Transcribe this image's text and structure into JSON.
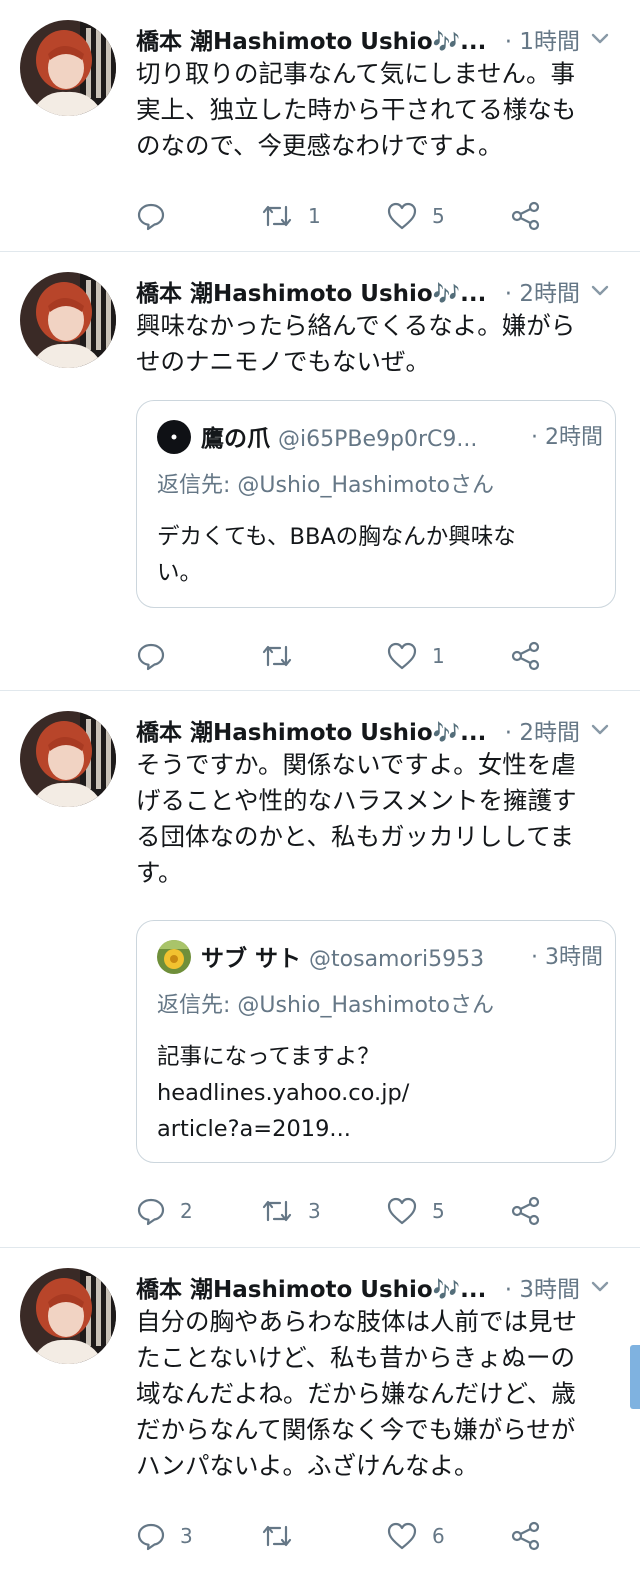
{
  "user": {
    "name": "橋本 潮Hashimoto Ushio",
    "music_glyph": "🎶",
    "ellipsis": "..."
  },
  "tweets": [
    {
      "time": "· 1時間",
      "text": [
        "切り取りの記事なんて気にしません。事",
        "実上、独立した時から干されてる様なも",
        "のなので、今更感なわけですよ。"
      ],
      "reply_count": "",
      "retweet_count": "1",
      "like_count": "5"
    },
    {
      "time": "· 2時間",
      "text": [
        "興味なかったら絡んでくるなよ。嫌がら",
        "せのナニモノでもないぜ。"
      ],
      "quote": {
        "name": "鷹の爪",
        "handle": "@i65PBe9p0rC9...",
        "time": "· 2時間",
        "reply_to": "返信先: @Ushio_Hashimotoさん",
        "text": [
          "デカくても、BBAの胸なんか興味な",
          "い。"
        ]
      },
      "reply_count": "",
      "retweet_count": "",
      "like_count": "1"
    },
    {
      "time": "· 2時間",
      "text": [
        "そうですか。関係ないですよ。女性を虐",
        "げることや性的なハラスメントを擁護す",
        "る団体なのかと、私もガッカリししてま",
        "す。"
      ],
      "quote": {
        "name": "サブ サト",
        "handle": "@tosamori5953",
        "time": "· 3時間",
        "reply_to": "返信先: @Ushio_Hashimotoさん",
        "text": [
          "記事になってますよ？",
          "headlines.yahoo.co.jp/",
          "article?a=2019..."
        ]
      },
      "reply_count": "2",
      "retweet_count": "3",
      "like_count": "5"
    },
    {
      "time": "· 3時間",
      "text": [
        "自分の胸やあらわな肢体は人前では見せ",
        "たことないけど、私も昔からきょぬーの",
        "域なんだよね。だから嫌なんだけど、歳",
        "だからなんて関係なく今でも嫌がらせが",
        "ハンパないよ。ふざけんなよ。"
      ],
      "reply_count": "3",
      "retweet_count": "",
      "like_count": "6"
    }
  ],
  "colors": {
    "text": "#14171a",
    "secondary": "#657786",
    "border": "#e1e8ed",
    "quote_border": "#ccd6dd",
    "accent": "#4f8fd8"
  },
  "icons": [
    "avatar-photo",
    "chevron-down-icon",
    "reply-icon",
    "retweet-icon",
    "like-icon",
    "share-icon"
  ]
}
